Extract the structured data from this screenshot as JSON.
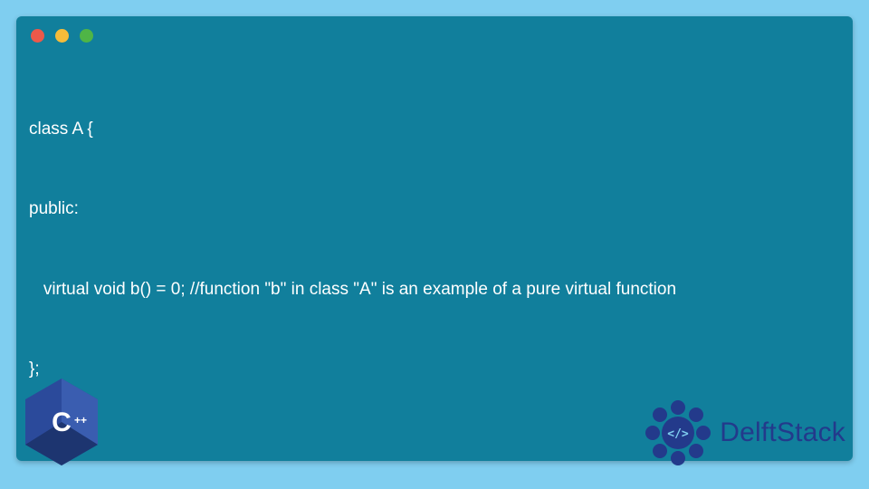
{
  "code": {
    "lines": [
      "class A {",
      "public:",
      "   virtual void b() = 0; //function \"b\" in class \"A\" is an example of a pure virtual function",
      "};"
    ]
  },
  "cpp_badge": {
    "label": "C++",
    "bg": "#2b4a9b",
    "shadow": "#1d3570"
  },
  "brand": {
    "name": "DelftStack",
    "color": "#233a8b"
  },
  "colors": {
    "page_bg": "#7fcef0",
    "window_bg": "#117f9c",
    "code_text": "#ffffff",
    "dot_red": "#ed594a",
    "dot_yellow": "#f6bc3a",
    "dot_green": "#4fb546"
  }
}
